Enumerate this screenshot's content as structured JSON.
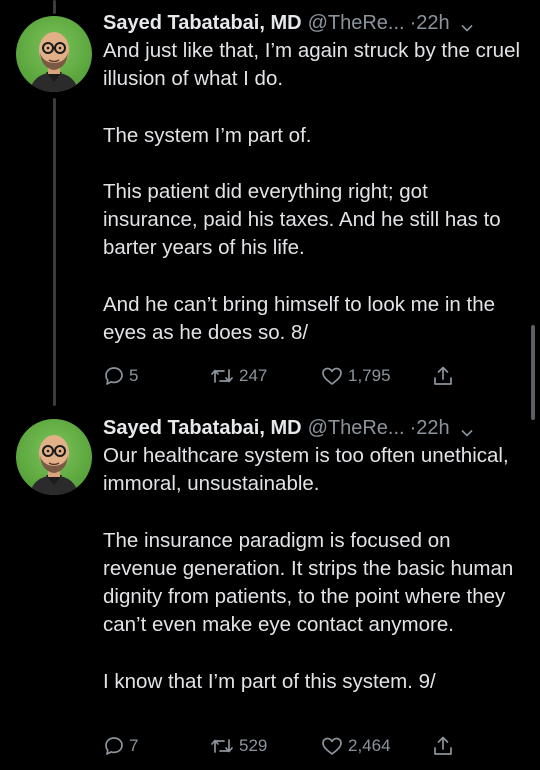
{
  "tweets": [
    {
      "author_name": "Sayed Tabatabai, MD",
      "handle": "@TheRe...",
      "separator": "·",
      "time": "22h",
      "paragraphs": [
        "And just like that, I’m again struck by the cruel illusion of what I do.",
        "The system I’m part of.",
        "This patient did everything right; got insurance, paid his taxes.  And he still has to barter years of his life.",
        "And he can’t bring himself to look me in the eyes as he does so. 8/"
      ],
      "replies": "5",
      "retweets": "247",
      "likes": "1,795"
    },
    {
      "author_name": "Sayed Tabatabai, MD",
      "handle": "@TheRe...",
      "separator": "·",
      "time": "22h",
      "paragraphs": [
        "Our healthcare system is too often unethical, immoral, unsustainable.",
        "The insurance paradigm is focused on revenue generation.  It strips the basic human dignity from patients, to the point where they can’t even make eye contact anymore.",
        "I know that I’m part of this system. 9/"
      ],
      "replies": "7",
      "retweets": "529",
      "likes": "2,464"
    }
  ],
  "icons": {
    "reply": "reply-icon",
    "retweet": "retweet-icon",
    "like": "like-icon",
    "share": "share-icon",
    "more": "chevron-down-icon"
  },
  "colors": {
    "background": "#000000",
    "text": "#e1e3e6",
    "secondary": "#8b949c",
    "avatar_bg": "#5ea840"
  }
}
